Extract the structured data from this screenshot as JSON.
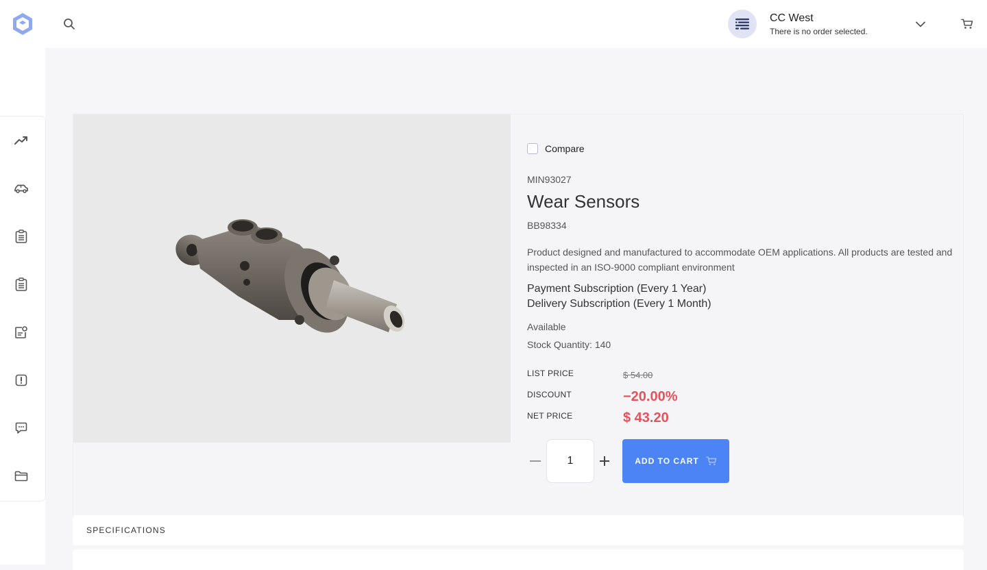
{
  "header": {
    "account_name": "CC West",
    "account_sub": "There is no order selected."
  },
  "sidebar": {
    "items": [
      {
        "icon": "trending-up-icon"
      },
      {
        "icon": "car-icon"
      },
      {
        "icon": "clipboard-list-icon"
      },
      {
        "icon": "clipboard-list-icon"
      },
      {
        "icon": "document-settings-icon"
      },
      {
        "icon": "alert-icon"
      },
      {
        "icon": "chat-icon"
      },
      {
        "icon": "folder-icon"
      }
    ]
  },
  "product": {
    "compare_label": "Compare",
    "sku": "MIN93027",
    "title": "Wear Sensors",
    "part_number": "BB98334",
    "description": "Product designed and manufactured to accommodate OEM applications. All products are tested and inspected in an ISO-9000 compliant environment",
    "payment_subscription": "Payment Subscription (Every 1 Year)",
    "delivery_subscription": "Delivery Subscription (Every 1 Month)",
    "availability": "Available",
    "stock": "Stock Quantity: 140",
    "list_price_label": "LIST PRICE",
    "list_price": "$ 54.00",
    "discount_label": "DISCOUNT",
    "discount": "−20.00%",
    "net_price_label": "NET PRICE",
    "net_price": "$ 43.20",
    "quantity": "1",
    "add_to_cart_label": "ADD TO CART"
  },
  "specifications": {
    "label": "SPECIFICATIONS"
  },
  "colors": {
    "primary": "#4d84f5",
    "price_red": "#e8505b",
    "logo": "#6b8fe8"
  }
}
